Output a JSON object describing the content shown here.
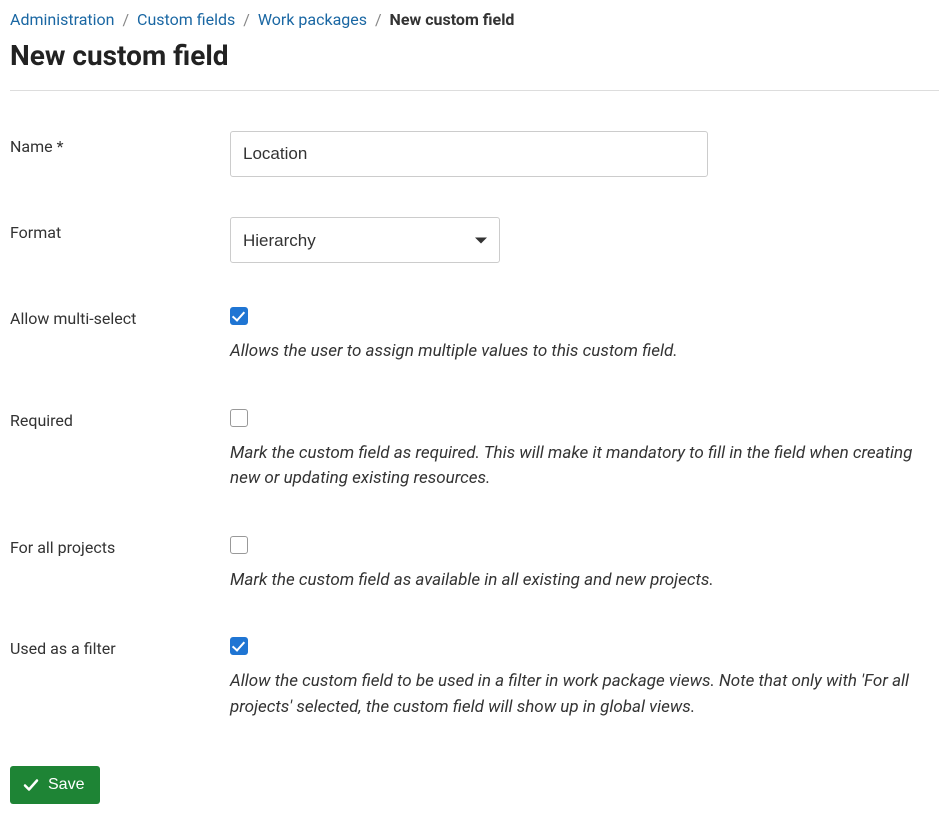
{
  "breadcrumbs": {
    "items": [
      {
        "label": "Administration"
      },
      {
        "label": "Custom fields"
      },
      {
        "label": "Work packages"
      }
    ],
    "current": "New custom field"
  },
  "page": {
    "title": "New custom field"
  },
  "form": {
    "name": {
      "label": "Name *",
      "value": "Location"
    },
    "format": {
      "label": "Format",
      "value": "Hierarchy"
    },
    "allow_multi": {
      "label": "Allow multi-select",
      "checked": true,
      "help": "Allows the user to assign multiple values to this custom field."
    },
    "required": {
      "label": "Required",
      "checked": false,
      "help": "Mark the custom field as required. This will make it mandatory to fill in the field when creating new or updating existing resources."
    },
    "for_all_projects": {
      "label": "For all projects",
      "checked": false,
      "help": "Mark the custom field as available in all existing and new projects."
    },
    "used_as_filter": {
      "label": "Used as a filter",
      "checked": true,
      "help": "Allow the custom field to be used in a filter in work package views. Note that only with 'For all projects' selected, the custom field will show up in global views."
    },
    "save_label": "Save"
  }
}
